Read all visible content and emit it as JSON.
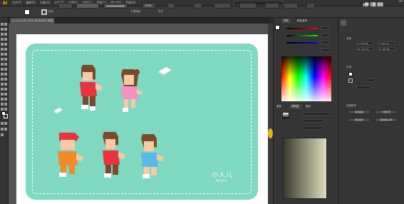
{
  "app": {
    "logo": "Ai"
  },
  "menu": {
    "items": [
      "文件(F)",
      "编辑(E)",
      "对象(O)",
      "文字(T)",
      "选择(S)",
      "效果(C)",
      "视图(V)",
      "窗口(W)",
      "帮助(H)"
    ]
  },
  "watermark": "虎课网",
  "control_bar": {
    "label_stroke": "描边",
    "style_label": "不透明度",
    "opacity_value": "100%",
    "style2": "样式"
  },
  "document_tab": {
    "title": "小人儿.ai @ 100% (RGB/GPU 预览)"
  },
  "artwork": {
    "title": "小人儿",
    "subtitle": "PEOPLE"
  },
  "color_panel": {
    "tab1": "颜色",
    "tab2": "颜色参考",
    "accent": "#7fd8c0"
  },
  "gradient_panel": {
    "tab1": "渐变",
    "tab2": "透明度",
    "tab3": "描边"
  },
  "properties_panel": {
    "section1": "变换",
    "section2": "外观",
    "section3": "快速操作",
    "buttons": [
      "取消编组",
      "扩展外观",
      "重新着色",
      "选择相似对象"
    ],
    "fields": [
      "X: 276.45",
      "Y: 402.72",
      "W: 153.29",
      "H: 200.96"
    ]
  }
}
